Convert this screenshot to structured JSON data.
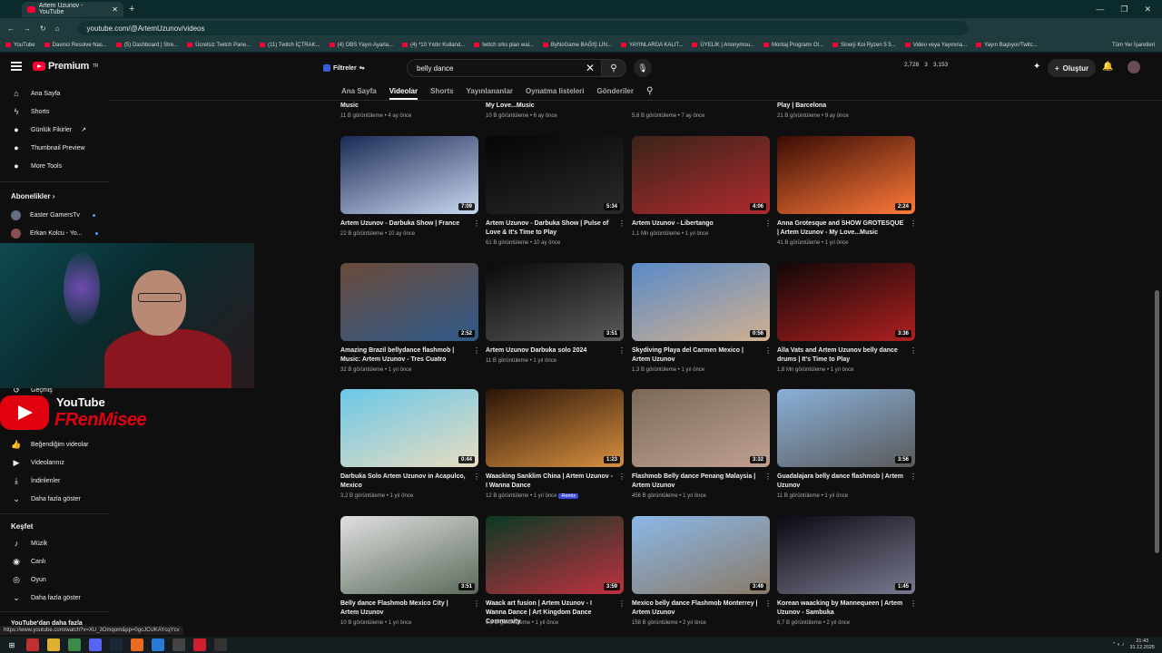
{
  "browser": {
    "tab_title": "Artem Uzunov - YouTube",
    "url": "youtube.com/@ArtemUzunov/videos",
    "bookmarks": [
      "YouTube",
      "Davinci Resolve Nas...",
      "(5) Dashboard | Stre...",
      "Ücretsiz Twitch Pane...",
      "(11) Twitch İÇTRAK...",
      "(4) OBS Yayın Ayarla...",
      "(4) *10 Yıldır Kulland...",
      "twitch srks plan wal...",
      "ByNoGame BAĞIŞ LİN...",
      "YAYINLARDA KALIT...",
      "ÜYELİK | Anonymou...",
      "Montaj Programı Ol...",
      "Sinerji Koi Ryzen 5 5...",
      "Video veya Yayınına...",
      "Yayın Başlıyor/Twitc..."
    ],
    "all_bookmarks": "Tüm Yer İşaretleri"
  },
  "header": {
    "logo": "Premium",
    "logo_sup": "TR",
    "filters": "Filtreler",
    "search_value": "belly dance",
    "stats": [
      "2,728",
      "3",
      "3,153"
    ],
    "create": "Oluştur"
  },
  "sidebar": {
    "items": [
      "Ana Sayfa",
      "Shorts",
      "Günlük Fikirler",
      "Thumbnail Preview",
      "More Tools"
    ],
    "subs_heading": "Abonelikler",
    "subs": [
      "Easter GamersTv",
      "Erkan Kolcu - Yo..."
    ],
    "you_items": [
      "Geçmiş",
      "Beğendiğim videolar",
      "Videolarınız",
      "İndirilenler",
      "Daha fazla göster"
    ],
    "explore_heading": "Keşfet",
    "explore": [
      "Müzik",
      "Canlı",
      "Oyun",
      "Daha fazla göster"
    ],
    "more_heading": "YouTube'dan daha fazla"
  },
  "overlay": {
    "yt": "YouTube",
    "name": "FRenMisee"
  },
  "channel_tabs": [
    "Ana Sayfa",
    "Videolar",
    "Shorts",
    "Yayınlananlar",
    "Oynatma listeleri",
    "Gönderiler"
  ],
  "top_partial": [
    {
      "title": "Music",
      "meta": "11 B görüntüleme • 4 ay önce"
    },
    {
      "title": "My Love...Music",
      "meta": "10 B görüntüleme • 6 ay önce"
    },
    {
      "title": "",
      "meta": "5,8 B görüntüleme • 7 ay önce"
    },
    {
      "title": "Play | Barcelona",
      "meta": "21 B görüntüleme • 9 ay önce"
    }
  ],
  "videos": [
    {
      "title": "Artem Uzunov - Darbuka Show | France",
      "meta": "22 B görüntüleme • 10 ay önce",
      "dur": "7:09",
      "c1": "#1b2a55",
      "c2": "#c9d8f0"
    },
    {
      "title": "Artem Uzunov - Darbuka Show | Pulse of Love & It's Time to Play",
      "meta": "61 B görüntüleme • 10 ay önce",
      "dur": "5:34",
      "c1": "#050505",
      "c2": "#2a2a2a"
    },
    {
      "title": "Artem Uzunov - Libertango",
      "meta": "1,1 Mn görüntüleme • 1 yıl önce",
      "dur": "4:06",
      "c1": "#3a2418",
      "c2": "#b02a30"
    },
    {
      "title": "Anna Grotesque and SHOW GROTESQUE | Artem Uzunov - My Love...Music",
      "meta": "41 B görüntüleme • 1 yıl önce",
      "dur": "2:24",
      "c1": "#3a0c04",
      "c2": "#ff7a3a"
    },
    {
      "title": "Amazing Brazil bellydance flashmob | Music: Artem Uzunov - Tres Cuatro",
      "meta": "32 B görüntüleme • 1 yıl önce",
      "dur": "2:52",
      "c1": "#6a4a3a",
      "c2": "#2f5a8a"
    },
    {
      "title": "Artem Uzunov Darbuka solo 2024",
      "meta": "11 B görüntüleme • 1 yıl önce",
      "dur": "3:51",
      "c1": "#0a0a0a",
      "c2": "#5a5a5a"
    },
    {
      "title": "Skydiving Playa del Carmen Mexico | Artem Uzunov",
      "meta": "1,3 B görüntüleme • 1 yıl önce",
      "dur": "0:56",
      "c1": "#5a8ac8",
      "c2": "#d0b090"
    },
    {
      "title": "Alla Vats and Artem Uzunov belly dance drums | It's Time to Play",
      "meta": "1,8 Mn görüntüleme • 1 yıl önce",
      "dur": "3:36",
      "c1": "#120808",
      "c2": "#b02020"
    },
    {
      "title": "Darbuka Solo Artem Uzunov in Acapulco, Mexico",
      "meta": "3,2 B görüntüleme • 1 yıl önce",
      "dur": "0:44",
      "c1": "#6ac8e8",
      "c2": "#e8dcc0"
    },
    {
      "title": "Waacking Sanklim China | Artem Uzunov - I Wanna Dance",
      "meta": "12 B görüntüleme • 1 yıl önce",
      "dur": "1:23",
      "badge": "Remix",
      "c1": "#2a1408",
      "c2": "#d89040"
    },
    {
      "title": "Flashmob Belly dance Penang Malaysia | Artem Uzunov",
      "meta": "456 B görüntüleme • 1 yıl önce",
      "dur": "3:32",
      "c1": "#7a6a58",
      "c2": "#c0a090"
    },
    {
      "title": "Guadalajara belly dance flashmob | Artem Uzunov",
      "meta": "11 B görüntüleme • 1 yıl önce",
      "dur": "3:56",
      "c1": "#8ab0d8",
      "c2": "#5a5a5a"
    },
    {
      "title": "Belly dance Flashmob Mexico City | Artem Uzunov",
      "meta": "10 B görüntüleme • 1 yıl önce",
      "dur": "3:51",
      "c1": "#e0e0e0",
      "c2": "#5a6a5a"
    },
    {
      "title": "Waack art fusion | Artem Uzunov - I Wanna Dance | Art Kingdom Dance Community",
      "meta": "6,8 B görüntüleme • 1 yıl önce",
      "dur": "3:59",
      "c1": "#0a3a24",
      "c2": "#c03040"
    },
    {
      "title": "Mexico belly dance Flashmob Monterrey | Artem Uzunov",
      "meta": "158 B görüntüleme • 2 yıl önce",
      "dur": "3:49",
      "c1": "#8ab8e8",
      "c2": "#8a7a68"
    },
    {
      "title": "Korean waacking by Mannequeen | Artem Uzunov - Sambuka",
      "meta": "6,7 B görüntüleme • 2 yıl önce",
      "dur": "1:45",
      "c1": "#0a0a14",
      "c2": "#7a7a90"
    }
  ],
  "statusbar": "https://www.youtube.com/watch?v=XU_3Omqom&pp=0gcJCUKAYcqYcv",
  "clock": {
    "time": "21:43",
    "date": "31.12.2025"
  }
}
